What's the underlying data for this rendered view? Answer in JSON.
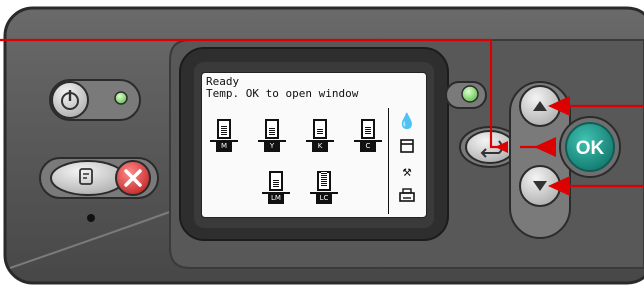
{
  "screen": {
    "status": "Ready",
    "message": "Temp. OK to open window",
    "ink_cartridges": [
      {
        "label": "M",
        "level": 0.55
      },
      {
        "label": "Y",
        "level": 0.45
      },
      {
        "label": "K",
        "level": 0.35
      },
      {
        "label": "C",
        "level": 0.5
      },
      {
        "label": "LM",
        "level": 0.45
      },
      {
        "label": "LC",
        "level": 1.0
      }
    ],
    "side_menu": [
      "ink-menu-icon",
      "paper-menu-icon",
      "setup-menu-icon",
      "printer-menu-icon"
    ]
  },
  "buttons": {
    "ok_label": "OK"
  },
  "colors": {
    "panel": "#4e4e4e",
    "bezel": "#2f2f2f",
    "ok_button": "#1e9a8c",
    "callout_arrow": "#dd0000",
    "led": "#8fe07a",
    "cancel": "#d33a3a"
  }
}
